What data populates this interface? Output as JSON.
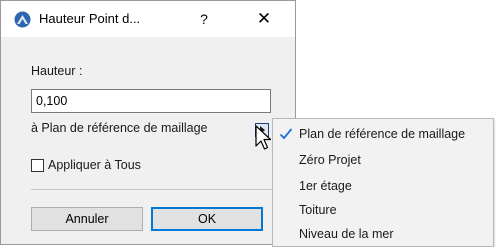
{
  "dialog": {
    "title": "Hauteur Point d...",
    "help_label": "?",
    "close_label": "✕",
    "height_label": "Hauteur :",
    "height_value": "0,100",
    "reference_label": "à Plan de référence de maillage",
    "apply_all_label": "Appliquer à Tous",
    "apply_all_checked": false,
    "cancel_label": "Annuler",
    "ok_label": "OK"
  },
  "reference_menu": {
    "selected": "Plan de référence de maillage",
    "items": [
      {
        "label": "Plan de référence de maillage",
        "checked": true
      },
      {
        "label": "Zéro Projet",
        "checked": false
      },
      {
        "label": "1er étage",
        "checked": false
      },
      {
        "label": "Toiture",
        "checked": false
      },
      {
        "label": "Niveau de la mer",
        "checked": false
      }
    ]
  },
  "colors": {
    "accent": "#0078d7",
    "check": "#1e6fd9",
    "icon": "#2e66b0"
  },
  "icons": {
    "app": "archicad-logo-icon",
    "help": "help-icon",
    "close": "close-icon",
    "menu_arrow": "chevron-right-icon",
    "cursor": "mouse-pointer-icon",
    "check": "checkmark-icon"
  }
}
